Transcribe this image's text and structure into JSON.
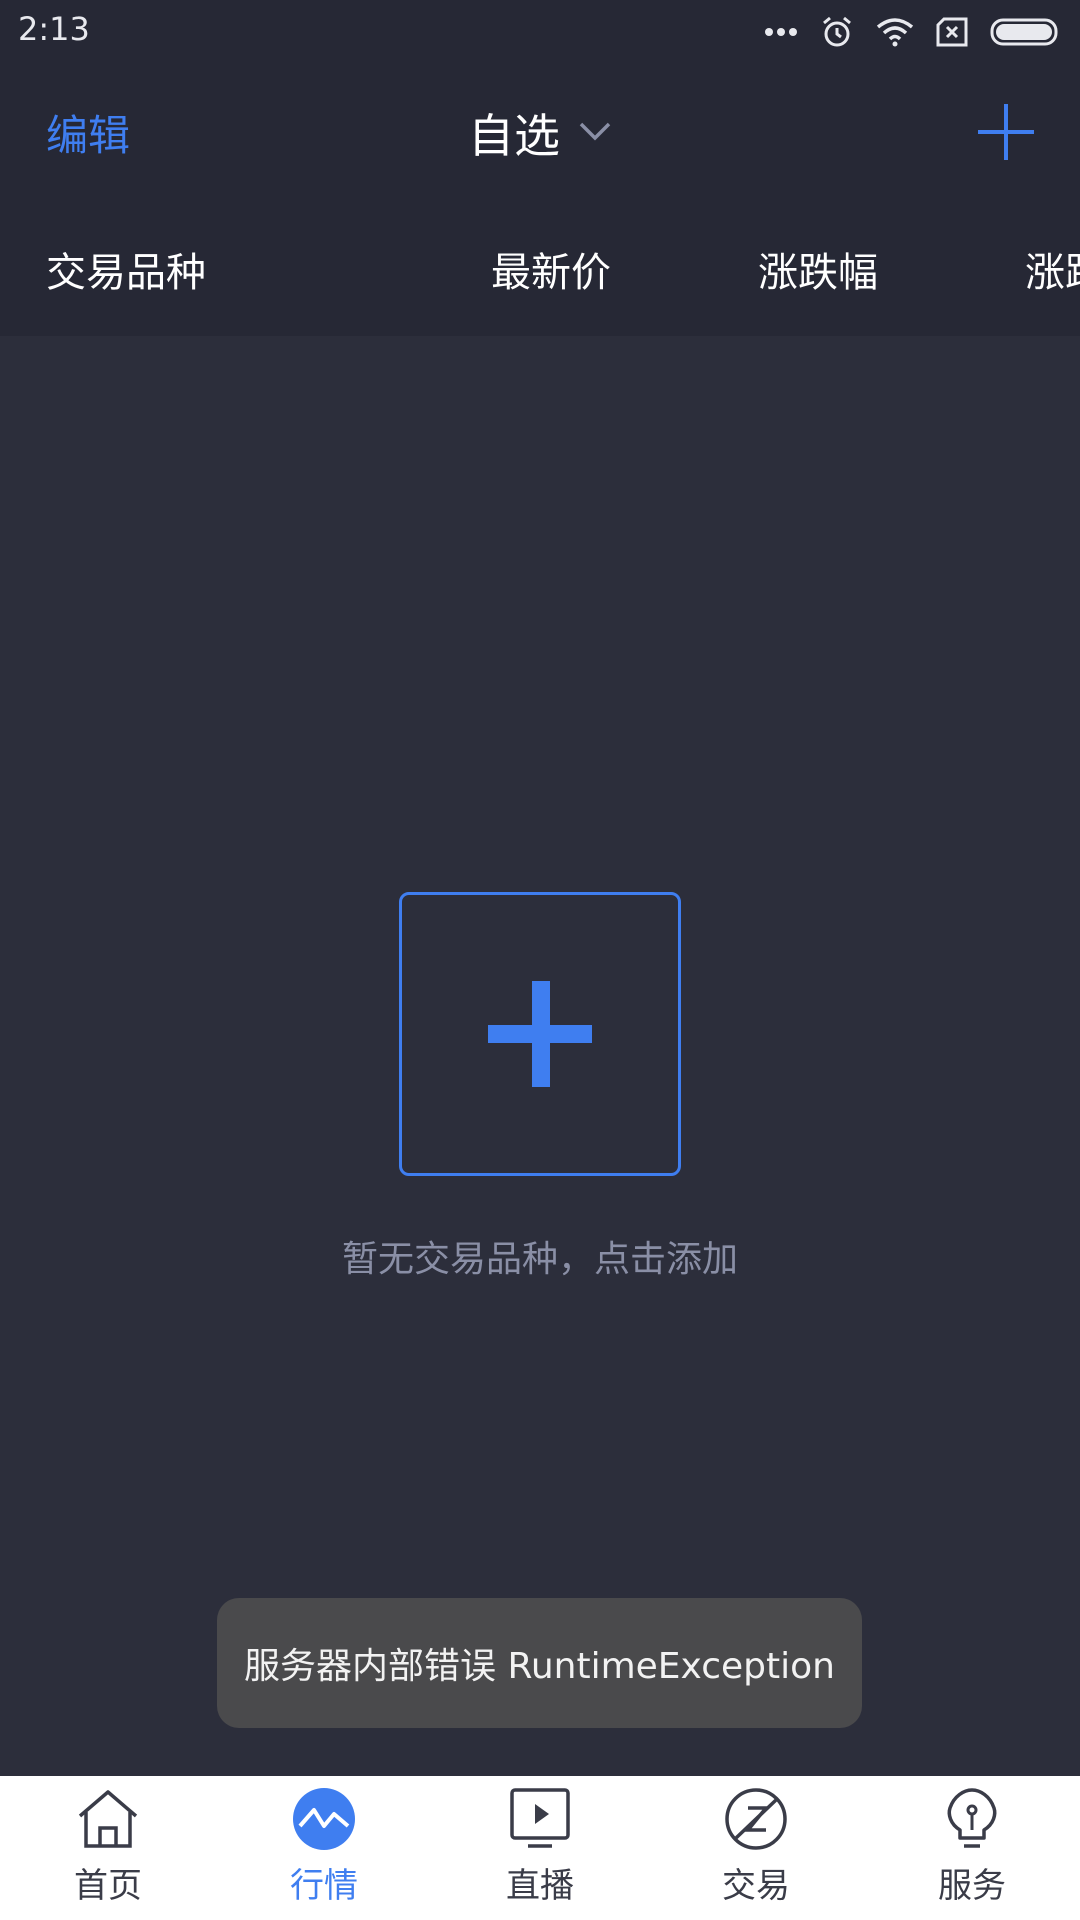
{
  "status_bar": {
    "time": "2:13",
    "icons": [
      "more-dots-icon",
      "alarm-icon",
      "wifi-icon",
      "no-sim-icon",
      "battery-icon"
    ]
  },
  "header": {
    "edit_label": "编辑",
    "title": "自选",
    "title_dropdown_icon": "chevron-down-icon",
    "add_icon": "plus-icon"
  },
  "columns": [
    "交易品种",
    "最新价",
    "涨跌幅",
    "涨跌"
  ],
  "empty_state": {
    "add_icon": "plus-icon",
    "message": "暂无交易品种，点击添加"
  },
  "toast": {
    "message": "服务器内部错误 RuntimeException"
  },
  "nav": {
    "items": [
      {
        "label": "首页",
        "icon": "home-icon",
        "active": false
      },
      {
        "label": "行情",
        "icon": "market-chart-icon",
        "active": true
      },
      {
        "label": "直播",
        "icon": "live-play-icon",
        "active": false
      },
      {
        "label": "交易",
        "icon": "trade-icon",
        "active": false
      },
      {
        "label": "服务",
        "icon": "service-bulb-icon",
        "active": false
      }
    ]
  },
  "colors": {
    "accent": "#3f7ef0",
    "background": "#2c2e3b",
    "header_background": "#262835",
    "muted_text": "#8a8fa6",
    "toast_background": "#4a4a4c"
  }
}
